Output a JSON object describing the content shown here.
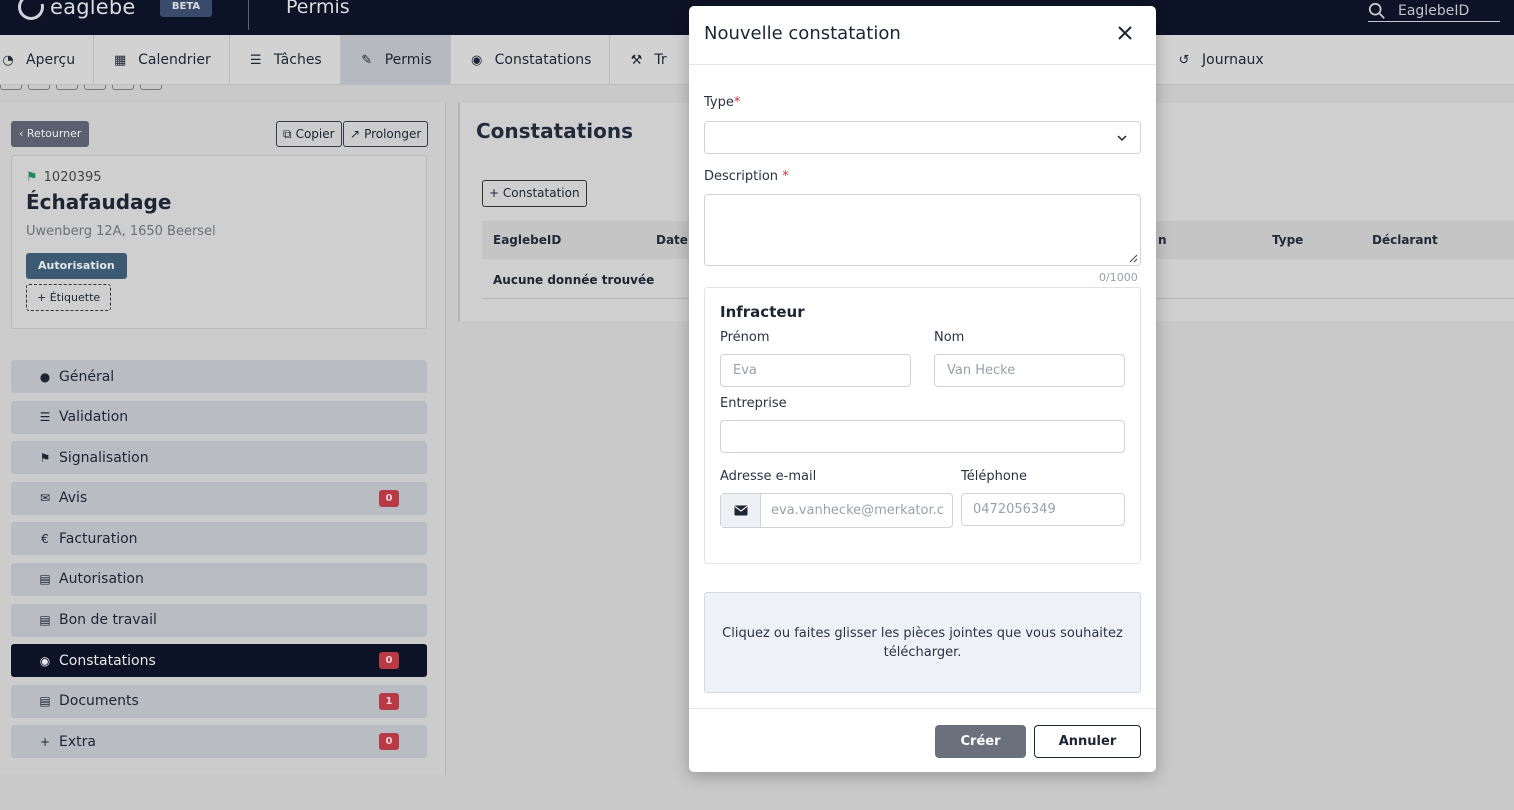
{
  "header": {
    "logo_text": "eaglebe",
    "beta": "BETA",
    "title": "Permis",
    "search_placeholder": "EaglebeID"
  },
  "tabs": [
    {
      "label": "Aperçu"
    },
    {
      "label": "Calendrier"
    },
    {
      "label": "Tâches"
    },
    {
      "label": "Permis"
    },
    {
      "label": "Constatations"
    },
    {
      "label": "Tr"
    },
    {
      "label": "Journaux"
    }
  ],
  "left": {
    "back": "Retourner",
    "copy": "Copier",
    "extend": "Prolonger",
    "permit": {
      "id": "1020395",
      "title": "Échafaudage",
      "address": "Uwenberg 12A, 1650 Beersel",
      "badge": "Autorisation",
      "tag": "+ Étiquette"
    },
    "menu": [
      {
        "label": "Général",
        "count": ""
      },
      {
        "label": "Validation",
        "count": ""
      },
      {
        "label": "Signalisation",
        "count": ""
      },
      {
        "label": "Avis",
        "count": "0"
      },
      {
        "label": "Facturation",
        "count": ""
      },
      {
        "label": "Autorisation",
        "count": ""
      },
      {
        "label": "Bon de travail",
        "count": ""
      },
      {
        "label": "Constatations",
        "count": "0"
      },
      {
        "label": "Documents",
        "count": "1"
      },
      {
        "label": "Extra",
        "count": "0"
      }
    ]
  },
  "content": {
    "title": "Constatations",
    "add_button": "+ Constatation",
    "columns": [
      "EaglebeID",
      "Date",
      "n",
      "Type",
      "Déclarant"
    ],
    "empty": "Aucune donnée trouvée"
  },
  "modal": {
    "title": "Nouvelle constatation",
    "type_label": "Type",
    "description_label": "Description",
    "counter": "0/1000",
    "offender_title": "Infracteur",
    "firstname_label": "Prénom",
    "firstname_placeholder": "Eva",
    "lastname_label": "Nom",
    "lastname_placeholder": "Van Hecke",
    "company_label": "Entreprise",
    "email_label": "Adresse e-mail",
    "email_placeholder": "eva.vanhecke@merkator.c",
    "phone_label": "Téléphone",
    "phone_placeholder": "0472056349",
    "dropzone": "Cliquez ou faites glisser les pièces jointes que vous souhaitez télécharger.",
    "create": "Créer",
    "cancel": "Annuler"
  },
  "colors": {
    "navy": "#0d1326",
    "danger": "#b83a44",
    "required": "#d0303c"
  }
}
